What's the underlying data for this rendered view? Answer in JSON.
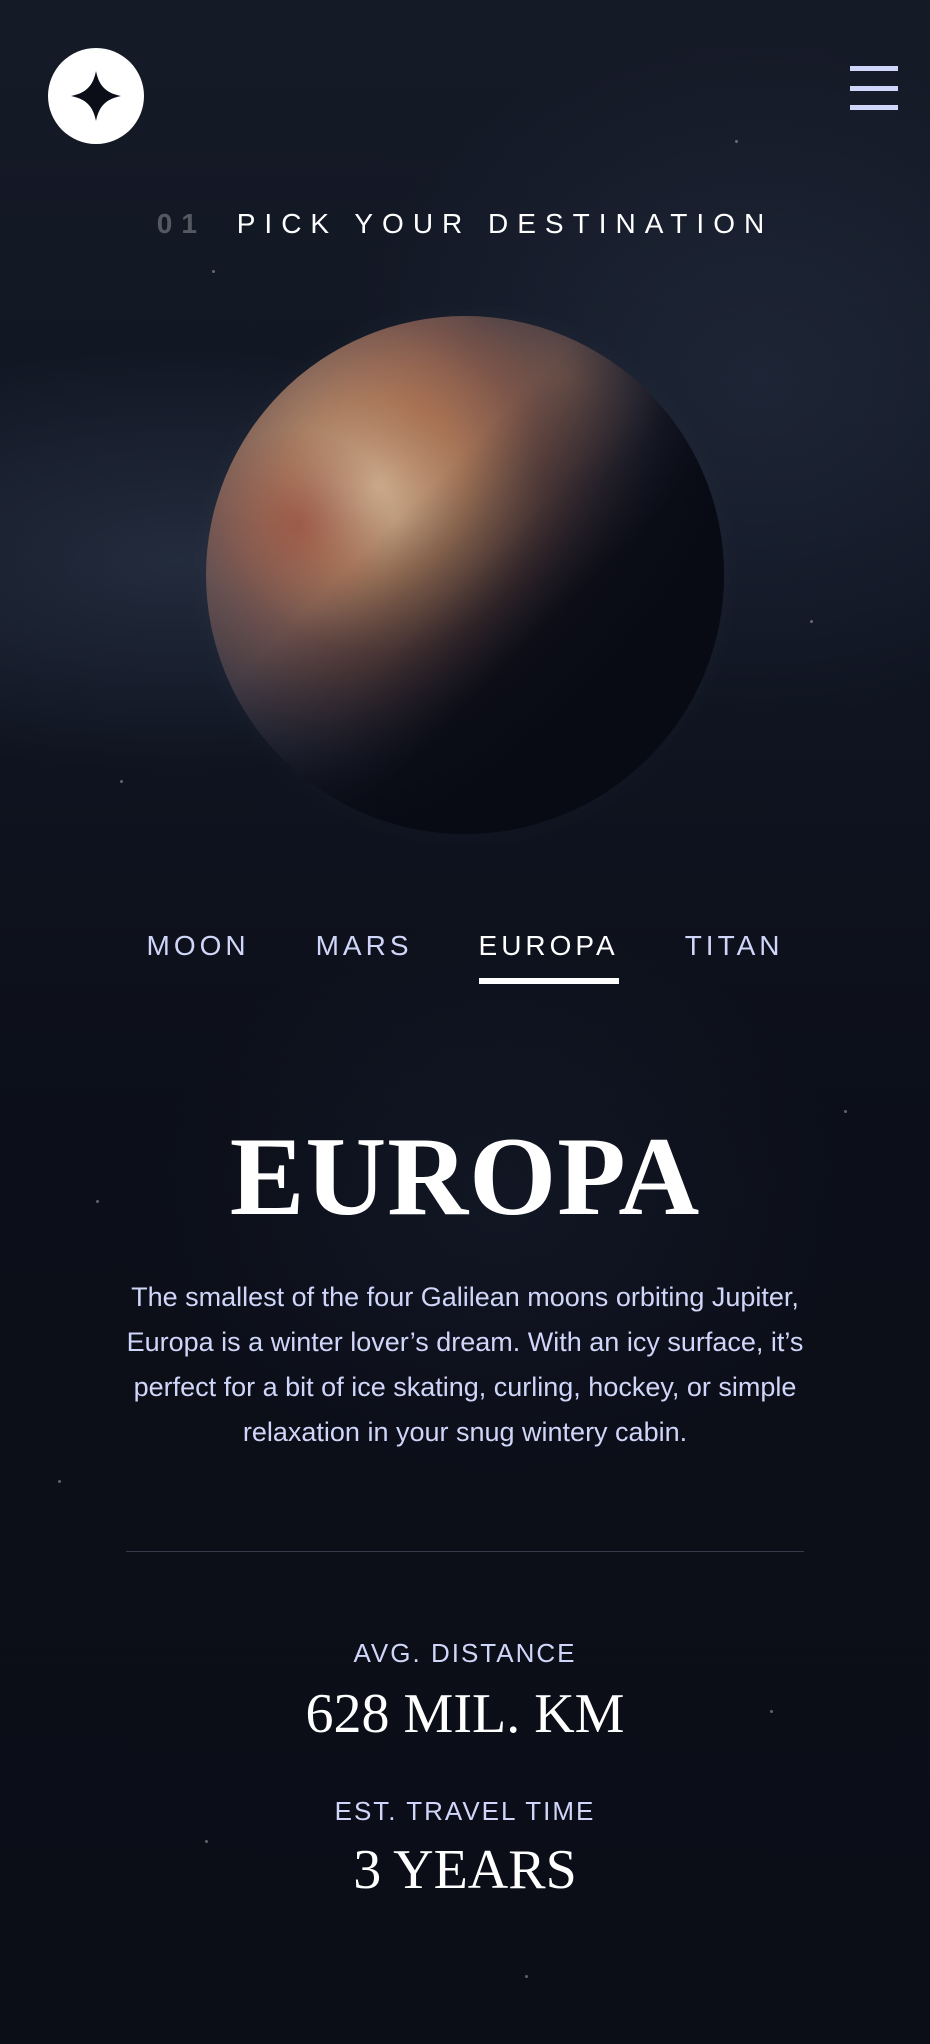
{
  "header": {
    "logo_icon": "star-logo-icon",
    "menu_icon": "hamburger-menu-icon"
  },
  "section": {
    "number": "01",
    "title": "PICK YOUR DESTINATION"
  },
  "tabs": [
    {
      "label": "MOON",
      "active": false
    },
    {
      "label": "MARS",
      "active": false
    },
    {
      "label": "EUROPA",
      "active": true
    },
    {
      "label": "TITAN",
      "active": false
    }
  ],
  "destination": {
    "name": "EUROPA",
    "description": "The smallest of the four Galilean moons orbiting Jupiter, Europa is a winter lover’s dream. With an icy surface, it’s perfect for a bit of ice skating, curling, hockey, or simple relaxation in your snug wintery cabin."
  },
  "stats": {
    "distance_label": "AVG. DISTANCE",
    "distance_value": "628 MIL. KM",
    "travel_label": "EST. TRAVEL TIME",
    "travel_value": "3 YEARS"
  },
  "colors": {
    "background": "#0b0d17",
    "accent": "#d0d6f9",
    "text": "#ffffff"
  }
}
